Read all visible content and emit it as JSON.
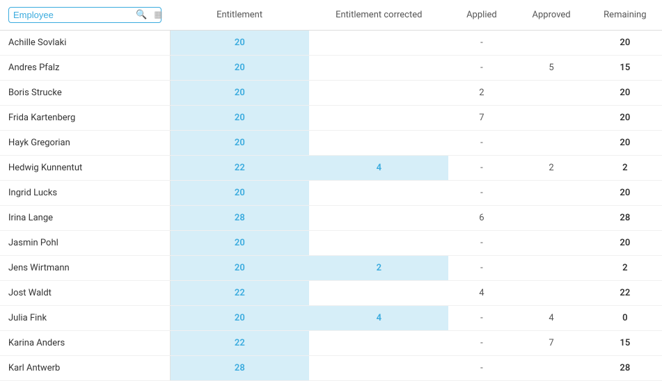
{
  "columns": {
    "employee": "Employee",
    "entitlement": "Entitlement",
    "entitlement_corrected": "Entitlement corrected",
    "applied": "Applied",
    "approved": "Approved",
    "remaining": "Remaining"
  },
  "search": {
    "placeholder": "Employee",
    "value": "Employee"
  },
  "rows": [
    {
      "name": "Achille Sovlaki",
      "entitlement": "20",
      "entitlement_corrected": "",
      "applied": "-",
      "approved": "",
      "remaining": "20"
    },
    {
      "name": "Andres Pfalz",
      "entitlement": "20",
      "entitlement_corrected": "",
      "applied": "-",
      "approved": "5",
      "remaining": "15"
    },
    {
      "name": "Boris Strucke",
      "entitlement": "20",
      "entitlement_corrected": "",
      "applied": "2",
      "approved": "",
      "remaining": "20"
    },
    {
      "name": "Frida Kartenberg",
      "entitlement": "20",
      "entitlement_corrected": "",
      "applied": "7",
      "approved": "",
      "remaining": "20"
    },
    {
      "name": "Hayk Gregorian",
      "entitlement": "20",
      "entitlement_corrected": "",
      "applied": "-",
      "approved": "",
      "remaining": "20"
    },
    {
      "name": "Hedwig Kunnentut",
      "entitlement": "22",
      "entitlement_corrected": "4",
      "applied": "-",
      "approved": "2",
      "remaining": "2"
    },
    {
      "name": "Ingrid Lucks",
      "entitlement": "20",
      "entitlement_corrected": "",
      "applied": "-",
      "approved": "",
      "remaining": "20"
    },
    {
      "name": "Irina Lange",
      "entitlement": "28",
      "entitlement_corrected": "",
      "applied": "6",
      "approved": "",
      "remaining": "28"
    },
    {
      "name": "Jasmin Pohl",
      "entitlement": "20",
      "entitlement_corrected": "",
      "applied": "-",
      "approved": "",
      "remaining": "20"
    },
    {
      "name": "Jens Wirtmann",
      "entitlement": "20",
      "entitlement_corrected": "2",
      "applied": "-",
      "approved": "",
      "remaining": "2"
    },
    {
      "name": "Jost Waldt",
      "entitlement": "22",
      "entitlement_corrected": "",
      "applied": "4",
      "approved": "",
      "remaining": "22"
    },
    {
      "name": "Julia Fink",
      "entitlement": "20",
      "entitlement_corrected": "4",
      "applied": "-",
      "approved": "4",
      "remaining": "0"
    },
    {
      "name": "Karina Anders",
      "entitlement": "22",
      "entitlement_corrected": "",
      "applied": "-",
      "approved": "7",
      "remaining": "15"
    },
    {
      "name": "Karl Antwerb",
      "entitlement": "28",
      "entitlement_corrected": "",
      "applied": "-",
      "approved": "",
      "remaining": "28"
    }
  ],
  "colors": {
    "accent": "#3aabde",
    "cell_bg": "#d6eef8"
  }
}
